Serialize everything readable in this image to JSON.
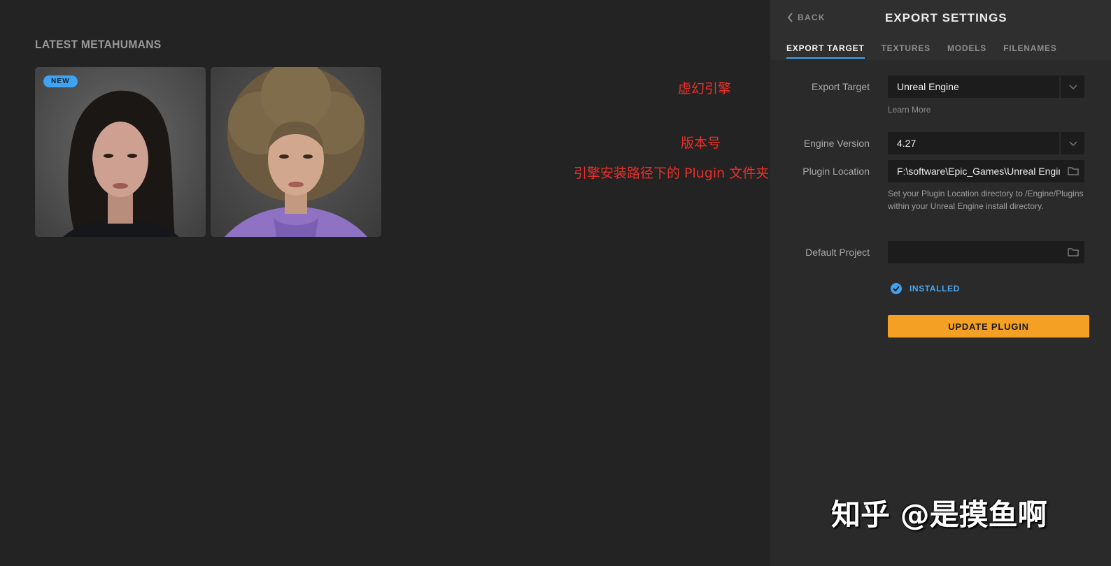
{
  "library": {
    "section_title": "LATEST METAHUMANS",
    "cards": [
      {
        "badge": "NEW"
      },
      {
        "badge": ""
      }
    ]
  },
  "annotations": {
    "export_target": "虚幻引擎",
    "engine_version": "版本号",
    "plugin_location": "引擎安装路径下的 Plugin 文件夹"
  },
  "panel": {
    "back_label": "BACK",
    "title": "EXPORT SETTINGS",
    "tabs": [
      {
        "label": "EXPORT TARGET",
        "active": true
      },
      {
        "label": "TEXTURES",
        "active": false
      },
      {
        "label": "MODELS",
        "active": false
      },
      {
        "label": "FILENAMES",
        "active": false
      }
    ],
    "export_target": {
      "label": "Export Target",
      "value": "Unreal Engine",
      "link": "Learn More"
    },
    "engine_version": {
      "label": "Engine Version",
      "value": "4.27"
    },
    "plugin_location": {
      "label": "Plugin Location",
      "value": "F:\\software\\Epic_Games\\Unreal Engine",
      "help": "Set your Plugin Location directory to /Engine/Plugins within your Unreal Engine install directory."
    },
    "default_project": {
      "label": "Default Project",
      "value": ""
    },
    "status": "INSTALLED",
    "update_button": "UPDATE PLUGIN"
  },
  "watermark": "知乎 @是摸鱼啊",
  "colors": {
    "background": "#232323",
    "panel": "#2a2a2a",
    "accent_blue": "#3fa3f2",
    "update_orange": "#f4a024",
    "annotation_red": "#e8302a"
  }
}
